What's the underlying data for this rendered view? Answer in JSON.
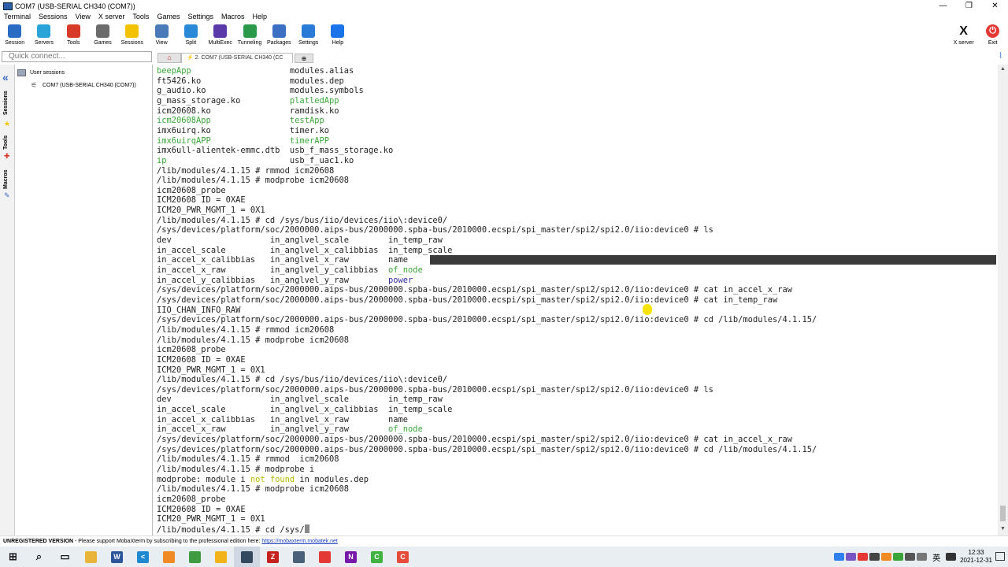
{
  "window": {
    "title": "COM7  (USB-SERIAL CH340 (COM7))",
    "controls": [
      "—",
      "❐",
      "✕"
    ]
  },
  "menu": [
    "Terminal",
    "Sessions",
    "View",
    "X server",
    "Tools",
    "Games",
    "Settings",
    "Macros",
    "Help"
  ],
  "toolbar": {
    "buttons": [
      {
        "label": "Session",
        "icon": "session-icon",
        "color": "#2a6bc4"
      },
      {
        "label": "Servers",
        "icon": "servers-icon",
        "color": "#2aa4d8"
      },
      {
        "label": "Tools",
        "icon": "tools-icon",
        "color": "#d83a2a"
      },
      {
        "label": "Games",
        "icon": "games-icon",
        "color": "#6b6b6b"
      },
      {
        "label": "Sessions",
        "icon": "star-icon",
        "color": "#f2c200"
      },
      {
        "label": "View",
        "icon": "view-icon",
        "color": "#4a7bb8"
      },
      {
        "label": "Split",
        "icon": "split-icon",
        "color": "#2a8ad8"
      },
      {
        "label": "MultiExec",
        "icon": "multiexec-icon",
        "color": "#5a3aa8"
      },
      {
        "label": "Tunneling",
        "icon": "tunneling-icon",
        "color": "#2a9a4a"
      },
      {
        "label": "Packages",
        "icon": "packages-icon",
        "color": "#3a6fc4"
      },
      {
        "label": "Settings",
        "icon": "gear-icon",
        "color": "#2a7ad8"
      },
      {
        "label": "Help",
        "icon": "help-icon",
        "color": "#1a73e8"
      }
    ],
    "xserver_label": "X server",
    "exit_label": "Exit"
  },
  "quick_connect": {
    "placeholder": "Quick connect..."
  },
  "tabs": {
    "active_label": "2. COM7  (USB-SERIAL CH340 (CC"
  },
  "sidebar": {
    "vertical_tabs": [
      "Sessions",
      "Tools",
      "Macros"
    ],
    "root_label": "User sessions",
    "session_item": "COM7  (USB-SERIAL CH340 (COM7))"
  },
  "terminal": {
    "lines": [
      [
        {
          "t": "beepApp",
          "c": "g"
        },
        {
          "t": "                    "
        },
        {
          "t": "modules.alias"
        }
      ],
      [
        {
          "t": "ft5426.ko"
        },
        {
          "t": "                  "
        },
        {
          "t": "modules.dep"
        }
      ],
      [
        {
          "t": "g_audio.ko"
        },
        {
          "t": "                 "
        },
        {
          "t": "modules.symbols"
        }
      ],
      [
        {
          "t": "g_mass_storage.ko"
        },
        {
          "t": "          "
        },
        {
          "t": "platledApp",
          "c": "g"
        }
      ],
      [
        {
          "t": "icm20608.ko"
        },
        {
          "t": "                "
        },
        {
          "t": "ramdisk.ko"
        }
      ],
      [
        {
          "t": "icm20608App",
          "c": "g"
        },
        {
          "t": "                "
        },
        {
          "t": "testApp",
          "c": "g"
        }
      ],
      [
        {
          "t": "imx6uirq.ko"
        },
        {
          "t": "                "
        },
        {
          "t": "timer.ko"
        }
      ],
      [
        {
          "t": "imx6uirqAPP",
          "c": "g"
        },
        {
          "t": "                "
        },
        {
          "t": "timerAPP",
          "c": "g"
        }
      ],
      [
        {
          "t": "imx6ull-alientek-emmc.dtb  usb_f_mass_storage.ko"
        }
      ],
      [
        {
          "t": "ip",
          "c": "g"
        },
        {
          "t": "                         "
        },
        {
          "t": "usb_f_uac1.ko"
        }
      ],
      [
        {
          "t": "/lib/modules/4.1.15 # rmmod icm20608"
        }
      ],
      [
        {
          "t": "/lib/modules/4.1.15 # modprobe icm20608"
        }
      ],
      [
        {
          "t": "icm20608_probe"
        }
      ],
      [
        {
          "t": "ICM20608 ID = 0XAE"
        }
      ],
      [
        {
          "t": "ICM20_PWR_MGMT_1 = 0X1"
        }
      ],
      [
        {
          "t": "/lib/modules/4.1.15 # cd /sys/bus/iio/devices/iio\\:device0/"
        }
      ],
      [
        {
          "t": "/sys/devices/platform/soc/2000000.aips-bus/2000000.spba-bus/2010000.ecspi/spi_master/spi2/spi2.0/iio:device0 # ls"
        }
      ],
      [
        {
          "t": "dev                    in_anglvel_scale        in_temp_raw"
        }
      ],
      [
        {
          "t": "in_accel_scale         in_anglvel_x_calibbias  in_temp_scale"
        }
      ],
      [
        {
          "t": "in_accel_x_calibbias   in_anglvel_x_raw        name"
        }
      ],
      [
        {
          "t": "in_accel_x_raw         in_anglvel_y_calibbias  "
        },
        {
          "t": "of_node",
          "c": "g"
        }
      ],
      [
        {
          "t": "in_accel_y_calibbias   in_anglvel_y_raw        "
        },
        {
          "t": "power",
          "c": "b"
        }
      ],
      [
        {
          "t": "/sys/devices/platform/soc/2000000.aips-bus/2000000.spba-bus/2010000.ecspi/spi_master/spi2/spi2.0/iio:device0 # cat in_accel_x_raw"
        }
      ],
      [
        {
          "t": "/sys/devices/platform/soc/2000000.aips-bus/2000000.spba-bus/2010000.ecspi/spi_master/spi2/spi2.0/iio:device0 # cat in_temp_raw"
        }
      ],
      [
        {
          "t": "IIO_CHAN_INFO_RAW"
        }
      ],
      [
        {
          "t": "/sys/devices/platform/soc/2000000.aips-bus/2000000.spba-bus/2010000.ecspi/spi_master/spi2/spi2.0/iio:device0 # cd /lib/modules/4.1.15/"
        }
      ],
      [
        {
          "t": "/lib/modules/4.1.15 # rmmod icm20608"
        }
      ],
      [
        {
          "t": "/lib/modules/4.1.15 # modprobe icm20608"
        }
      ],
      [
        {
          "t": "icm20608_probe"
        }
      ],
      [
        {
          "t": "ICM20608 ID = 0XAE"
        }
      ],
      [
        {
          "t": "ICM20_PWR_MGMT_1 = 0X1"
        }
      ],
      [
        {
          "t": "/lib/modules/4.1.15 # cd /sys/bus/iio/devices/iio\\:device0/"
        }
      ],
      [
        {
          "t": "/sys/devices/platform/soc/2000000.aips-bus/2000000.spba-bus/2010000.ecspi/spi_master/spi2/spi2.0/iio:device0 # ls"
        }
      ],
      [
        {
          "t": "dev                    in_anglvel_scale        in_temp_raw"
        }
      ],
      [
        {
          "t": "in_accel_scale         in_anglvel_x_calibbias  in_temp_scale"
        }
      ],
      [
        {
          "t": "in_accel_x_calibbias   in_anglvel_x_raw        name"
        }
      ],
      [
        {
          "t": "in_accel_x_raw         in_anglvel_y_raw        "
        },
        {
          "t": "of_node",
          "c": "g"
        }
      ],
      [
        {
          "t": "/sys/devices/platform/soc/2000000.aips-bus/2000000.spba-bus/2010000.ecspi/spi_master/spi2/spi2.0/iio:device0 # cat in_accel_x_raw"
        }
      ],
      [
        {
          "t": "/sys/devices/platform/soc/2000000.aips-bus/2000000.spba-bus/2010000.ecspi/spi_master/spi2/spi2.0/iio:device0 # cd /lib/modules/4.1.15/"
        }
      ],
      [
        {
          "t": "/lib/modules/4.1.15 # rmmod  icm20608"
        }
      ],
      [
        {
          "t": "/lib/modules/4.1.15 # modprobe i"
        }
      ],
      [
        {
          "t": "modprobe: module i "
        },
        {
          "t": "not found",
          "c": "y"
        },
        {
          "t": " in modules.dep"
        }
      ],
      [
        {
          "t": "/lib/modules/4.1.15 # modprobe icm20608"
        }
      ],
      [
        {
          "t": "icm20608_probe"
        }
      ],
      [
        {
          "t": "ICM20608 ID = 0XAE"
        }
      ],
      [
        {
          "t": "ICM20_PWR_MGMT_1 = 0X1"
        }
      ],
      [
        {
          "t": "/lib/modules/4.1.15 # cd /sys/"
        },
        {
          "t": "",
          "cursor": true
        }
      ]
    ]
  },
  "status": {
    "badge": "UNREGISTERED VERSION",
    "message": "  -  Please support MobaXterm by subscribing to the professional edition here:  ",
    "url": "https://mobaxterm.mobatek.net"
  },
  "taskbar": {
    "apps": [
      {
        "name": "start-icon",
        "glyph": "⊞",
        "color": "#1a1a1a"
      },
      {
        "name": "search-icon",
        "glyph": "⌕",
        "color": "#1a1a1a"
      },
      {
        "name": "task-view-icon",
        "glyph": "▭",
        "color": "#1a1a1a"
      },
      {
        "name": "file-explorer-icon",
        "glyph": "",
        "color": "#e8b53a"
      },
      {
        "name": "word-icon",
        "glyph": "W",
        "color": "#2b579a"
      },
      {
        "name": "vscode-icon",
        "glyph": "<",
        "color": "#1f8ad2"
      },
      {
        "name": "orange-app-icon",
        "glyph": "",
        "color": "#f08a24"
      },
      {
        "name": "green-doc-icon",
        "glyph": "",
        "color": "#3f9b3f"
      },
      {
        "name": "folder-app-icon",
        "glyph": "",
        "color": "#f2b21a"
      },
      {
        "name": "mobaxterm-icon",
        "glyph": "",
        "color": "#34495e"
      },
      {
        "name": "filezilla-icon",
        "glyph": "Z",
        "color": "#c5221f"
      },
      {
        "name": "calculator-icon",
        "glyph": "",
        "color": "#4a6078"
      },
      {
        "name": "red-app-icon",
        "glyph": "",
        "color": "#e53935"
      },
      {
        "name": "onenote-icon",
        "glyph": "N",
        "color": "#7719aa"
      },
      {
        "name": "c-app-icon",
        "glyph": "C",
        "color": "#3fb23f"
      },
      {
        "name": "clion-icon",
        "glyph": "C",
        "color": "#e54c3c"
      }
    ],
    "ime": "英",
    "time": "12:33",
    "date": "2021-12-31"
  },
  "colors": {
    "prompt_text": "#222222",
    "executable": "#3aa63a",
    "directory": "#2c2c9c",
    "warning": "#b8b800"
  }
}
